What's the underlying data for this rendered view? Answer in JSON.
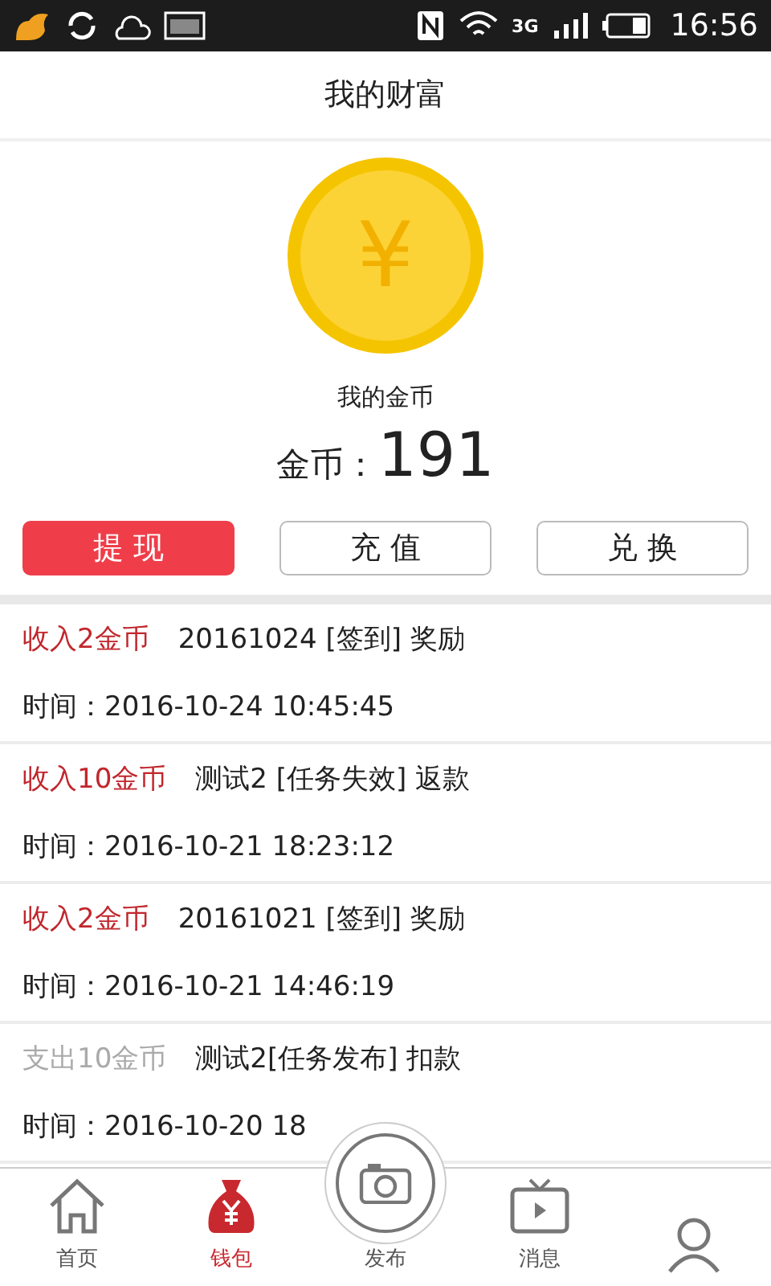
{
  "status_bar": {
    "time": "16:56",
    "network": "3G"
  },
  "header": {
    "title": "我的财富"
  },
  "wallet": {
    "coin_symbol": "¥",
    "caption": "我的金币",
    "balance_label": "金币：",
    "balance": "191"
  },
  "actions": [
    {
      "label": "提 现",
      "selected": true
    },
    {
      "label": "充 值",
      "selected": false
    },
    {
      "label": "兑 换",
      "selected": false
    }
  ],
  "records": [
    {
      "kind": "income",
      "amount": "收入2金币",
      "description": "20161024 [签到] 奖励",
      "time": "时间：2016-10-24 10:45:45"
    },
    {
      "kind": "income",
      "amount": "收入10金币",
      "description": "测试2 [任务失效] 返款",
      "time": "时间：2016-10-21 18:23:12"
    },
    {
      "kind": "income",
      "amount": "收入2金币",
      "description": "20161021 [签到] 奖励",
      "time": "时间：2016-10-21 14:46:19"
    },
    {
      "kind": "expense",
      "amount": "支出10金币",
      "description": "测试2[任务发布] 扣款",
      "time": "时间：2016-10-20 18"
    }
  ],
  "tabs": [
    {
      "kind": "home",
      "label": "首页",
      "selected": false
    },
    {
      "kind": "wallet",
      "label": "钱包",
      "selected": true
    },
    {
      "kind": "publish",
      "label": "发布",
      "selected": false
    },
    {
      "kind": "messages",
      "label": "消息",
      "selected": false
    },
    {
      "kind": "profile",
      "selected": false
    }
  ]
}
